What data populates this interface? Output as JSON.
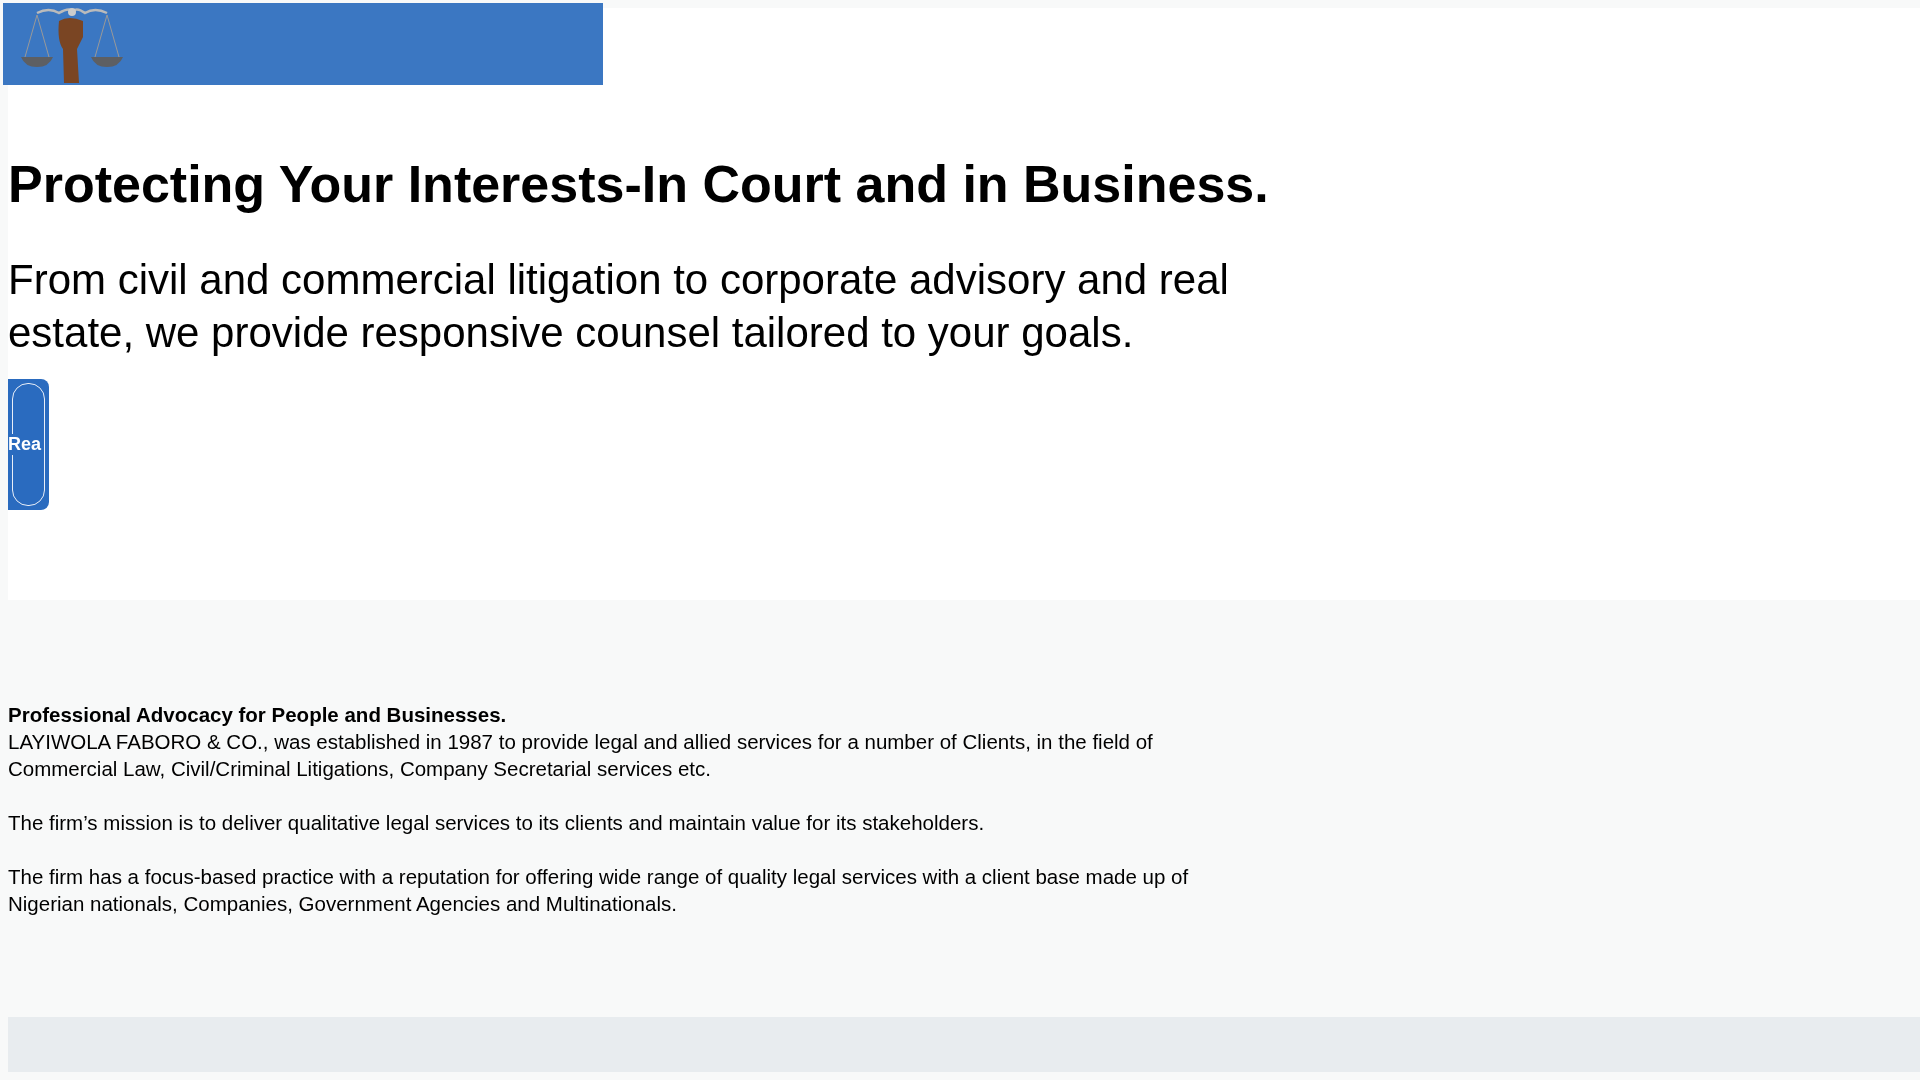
{
  "header": {
    "logo": {
      "kind": "logo"
    }
  },
  "hero": {
    "title": "Protecting Your Interests-In Court and in Business.",
    "subtitle": "From civil and commercial litigation to corporate advisory and real estate, we provide responsive counsel tailored to your goals.",
    "button": "Rea"
  },
  "about": {
    "heading": "Professional Advocacy for People and Businesses.",
    "paragraphs": [
      "LAYIWOLA FABORO & CO., was established in 1987 to provide legal and allied services for a number of Clients, in the field of Commercial Law, Civil/Criminal Litigations, Company Secretarial services etc.",
      "The firm’s mission is to deliver qualitative legal services to its clients and maintain value for its stakeholders.",
      "The firm has a focus-based practice with a reputation for offering wide range of quality legal services with a client base made up of Nigerian nationals, Companies, Government Agencies and Multinationals."
    ]
  }
}
